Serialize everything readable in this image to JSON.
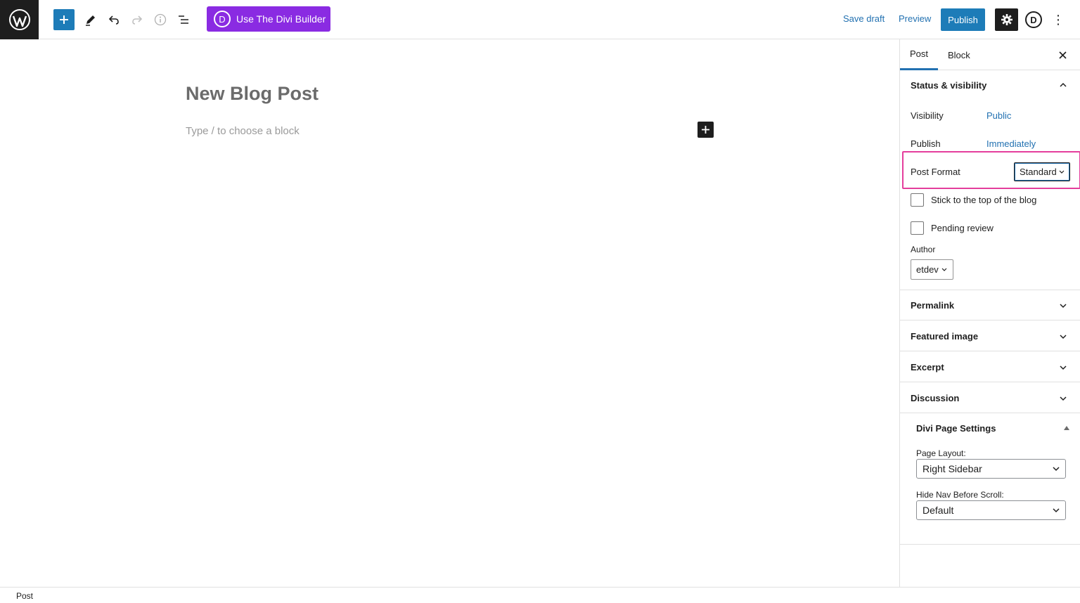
{
  "toolbar": {
    "divi_button_label": "Use The Divi Builder",
    "divi_letter": "D",
    "save_draft": "Save draft",
    "preview": "Preview",
    "publish": "Publish",
    "divi_icon_letter": "D",
    "more": "⋮",
    "icons": [
      "wordpress-logo",
      "plus",
      "pencil",
      "undo",
      "redo",
      "info",
      "list-view",
      "gear",
      "divi",
      "more-vertical"
    ]
  },
  "editor": {
    "title": "New Blog Post",
    "placeholder": "Type / to choose a block"
  },
  "sidebar": {
    "tabs": [
      {
        "label": "Post",
        "active": true
      },
      {
        "label": "Block",
        "active": false
      }
    ],
    "status_visibility": {
      "title": "Status & visibility",
      "visibility_label": "Visibility",
      "visibility_value": "Public",
      "publish_label": "Publish",
      "publish_value": "Immediately",
      "post_format_label": "Post Format",
      "post_format_value": "Standard",
      "stick_label": "Stick to the top of the blog",
      "pending_label": "Pending review",
      "author_label": "Author",
      "author_value": "etdev"
    },
    "panels": [
      {
        "title": "Permalink"
      },
      {
        "title": "Featured image"
      },
      {
        "title": "Excerpt"
      },
      {
        "title": "Discussion"
      }
    ],
    "divi": {
      "title": "Divi Page Settings",
      "page_layout_label": "Page Layout:",
      "page_layout_value": "Right Sidebar",
      "hide_nav_label": "Hide Nav Before Scroll:",
      "hide_nav_value": "Default"
    }
  },
  "footer": {
    "breadcrumb": "Post"
  },
  "colors": {
    "accent": "#2271b1",
    "publish_bg": "#1d7cb8",
    "divi_purple": "#8a2be2",
    "highlight": "#e43e9c"
  }
}
